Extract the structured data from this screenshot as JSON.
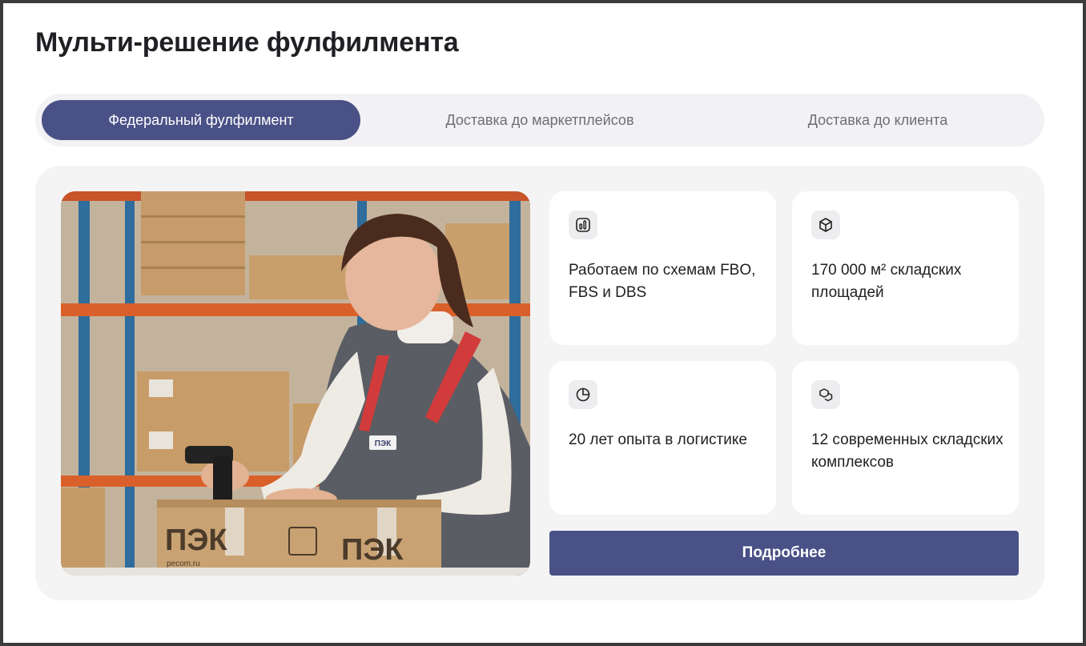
{
  "page": {
    "title": "Мульти-решение фулфилмента"
  },
  "tabs": [
    {
      "label": "Федеральный фулфилмент",
      "active": true
    },
    {
      "label": "Доставка до маркетплейсов",
      "active": false
    },
    {
      "label": "Доставка до клиента",
      "active": false
    }
  ],
  "photo": {
    "box_brand": "ПЭК",
    "box_site": "pecom.ru",
    "badge": "ПЭК"
  },
  "features": [
    {
      "icon": "chart-icon",
      "text": "Работаем по схемам FBO, FBS и DBS"
    },
    {
      "icon": "box-icon",
      "text": "170 000 м² складских площадей"
    },
    {
      "icon": "pie-chart-icon",
      "text": "20 лет опыта в логистике"
    },
    {
      "icon": "cubes-icon",
      "text": "12 современных складских комплексов"
    }
  ],
  "cta": {
    "label": "Подробнее"
  },
  "colors": {
    "accent": "#4a5187",
    "panel": "#f4f4f5",
    "tabs_bg": "#f2f2f4"
  }
}
